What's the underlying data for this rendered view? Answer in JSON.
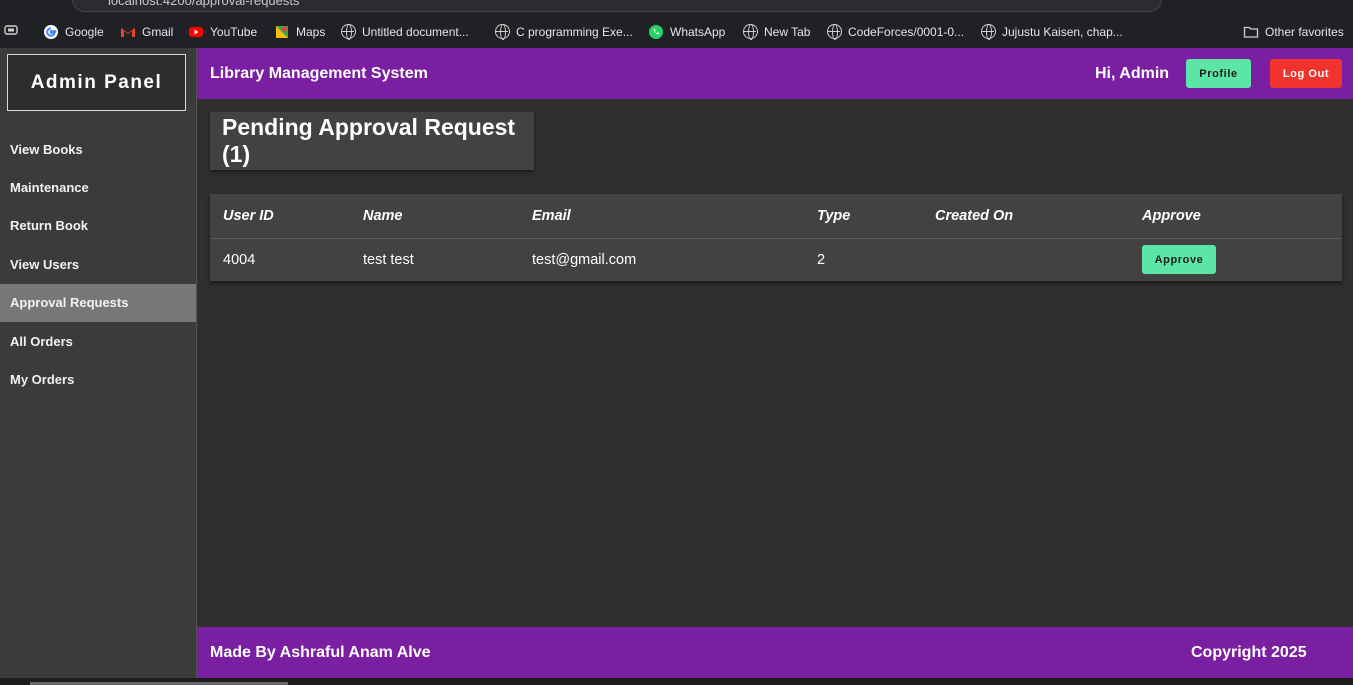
{
  "browser": {
    "url": "localhost:4200/approval-requests",
    "bookmarks": [
      {
        "label": "Google",
        "icon": "google-icon"
      },
      {
        "label": "Gmail",
        "icon": "gmail-icon"
      },
      {
        "label": "YouTube",
        "icon": "youtube-icon"
      },
      {
        "label": "Maps",
        "icon": "maps-icon"
      },
      {
        "label": "Untitled document...",
        "icon": "globe-icon"
      },
      {
        "label": "C programming Exe...",
        "icon": "globe-icon"
      },
      {
        "label": "WhatsApp",
        "icon": "whatsapp-icon"
      },
      {
        "label": "New Tab",
        "icon": "globe-icon"
      },
      {
        "label": "CodeForces/0001-0...",
        "icon": "globe-icon"
      },
      {
        "label": "Jujustu Kaisen, chap...",
        "icon": "globe-icon"
      }
    ],
    "other_favorites": "Other favorites"
  },
  "sidebar": {
    "brand": "Admin Panel",
    "items": [
      {
        "label": "View Books",
        "active": false
      },
      {
        "label": "Maintenance",
        "active": false
      },
      {
        "label": "Return Book",
        "active": false
      },
      {
        "label": "View Users",
        "active": false
      },
      {
        "label": "Approval Requests",
        "active": true
      },
      {
        "label": "All Orders",
        "active": false
      },
      {
        "label": "My Orders",
        "active": false
      }
    ]
  },
  "header": {
    "title": "Library Management System",
    "greeting": "Hi, Admin",
    "profile_label": "Profile",
    "logout_label": "Log Out"
  },
  "main": {
    "heading": "Pending Approval Request (1)",
    "table": {
      "columns": [
        "User ID",
        "Name",
        "Email",
        "Type",
        "Created On",
        "Approve"
      ],
      "rows": [
        {
          "user_id": "4004",
          "name": "test test",
          "email": "test@gmail.com",
          "type": "2",
          "created_on": "",
          "action_label": "Approve"
        }
      ]
    }
  },
  "footer": {
    "made_by": "Made By Ashraful Anam Alve",
    "copyright": "Copyright 2025"
  },
  "colors": {
    "accent_purple": "#7b1fa2",
    "profile_green": "#5be6a8",
    "logout_red": "#f0332d",
    "sidebar_bg": "#3b3b3b",
    "content_bg": "#2f2f2f"
  }
}
